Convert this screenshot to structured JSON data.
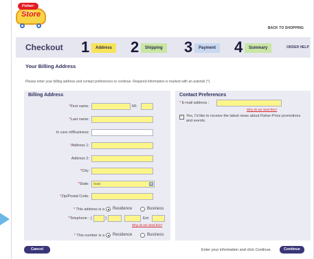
{
  "header": {
    "logo_brand": "Fisher-Price",
    "logo_word": "Store",
    "back_link": "BACK TO SHOPPING"
  },
  "steps": {
    "title": "Checkout",
    "items": [
      {
        "num": "1",
        "label": "Address"
      },
      {
        "num": "2",
        "label": "Shipping"
      },
      {
        "num": "3",
        "label": "Payment"
      },
      {
        "num": "4",
        "label": "Summary"
      }
    ],
    "order_help": "ORDER HELP"
  },
  "page": {
    "heading": "Your Billing Address",
    "intro": "Please enter your billing address and contact preferences to continue. Required information is marked with an asterisk (*)."
  },
  "billing": {
    "title": "Billing Address",
    "first_name": "First name:",
    "mi": "MI:",
    "last_name": "Last name:",
    "care_of": "In care of/Business:",
    "address1": "Address 1:",
    "address2": "Address 2:",
    "city": "City:",
    "state": "State:",
    "state_value": "State",
    "zip": "Zip/Postal Code:",
    "address_is": "This address is a",
    "residence": "Residence",
    "business": "Business",
    "telephone": "Telephone :",
    "paren_open": "(",
    "paren_close": ")",
    "ext": "Ext:",
    "why_phone": "Why do we need this?",
    "number_is": "This number is a",
    "star": "*"
  },
  "contact": {
    "title": "Contact Preferences",
    "email": "E-mail address :",
    "why_email": "Why do we need this?",
    "check_mark": "✓",
    "optin": "Yes, I'd like to receive the latest news about Fisher-Price promotions and events."
  },
  "footer": {
    "cancel": "Cancel",
    "instruction": "Enter your information and click Continue.",
    "continue": "Continue"
  },
  "colors": {
    "required_field": "#fbf58a",
    "button": "#3a3578",
    "panel": "#ebebf4",
    "accent_red": "#e31b23"
  }
}
